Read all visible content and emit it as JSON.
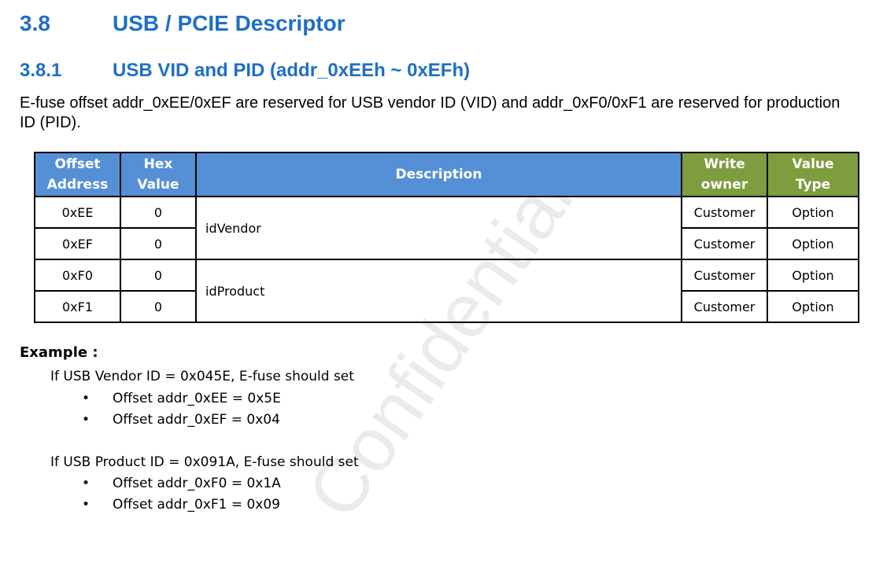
{
  "section": {
    "number": "3.8",
    "title": "USB / PCIE Descriptor"
  },
  "subsection": {
    "number": "3.8.1",
    "title": "USB VID and PID (addr_0xEEh ~ 0xEFh)"
  },
  "intro": "E-fuse offset addr_0xEE/0xEF are reserved for USB vendor ID (VID) and addr_0xF0/0xF1 are reserved for production ID (PID).",
  "table": {
    "headers": {
      "offset_line1": "Offset",
      "offset_line2": "Address",
      "hex_line1": "Hex",
      "hex_line2": "Value",
      "description": "Description",
      "owner_line1": "Write",
      "owner_line2": "owner",
      "type_line1": "Value",
      "type_line2": "Type"
    },
    "rows": [
      {
        "offset": "0xEE",
        "hex": "0",
        "owner": "Customer",
        "type": "Option"
      },
      {
        "offset": "0xEF",
        "hex": "0",
        "owner": "Customer",
        "type": "Option"
      },
      {
        "offset": "0xF0",
        "hex": "0",
        "owner": "Customer",
        "type": "Option"
      },
      {
        "offset": "0xF1",
        "hex": "0",
        "owner": "Customer",
        "type": "Option"
      }
    ],
    "descriptions": [
      "idVendor",
      "idProduct"
    ]
  },
  "example": {
    "title": "Example :",
    "vendor_line": "If USB Vendor ID = 0x045E, E-fuse should set",
    "vendor_bullets": [
      "Offset addr_0xEE = 0x5E",
      "Offset addr_0xEF = 0x04"
    ],
    "product_line": "If USB Product ID = 0x091A, E-fuse should set",
    "product_bullets": [
      "Offset addr_0xF0 = 0x1A",
      "Offset addr_0xF1 = 0x09"
    ],
    "bullet_glyph": "•"
  },
  "watermark": "Confidential",
  "colors": {
    "heading": "#1f6fc5",
    "header_blue": "#5590d6",
    "header_green": "#7e9d3f"
  }
}
